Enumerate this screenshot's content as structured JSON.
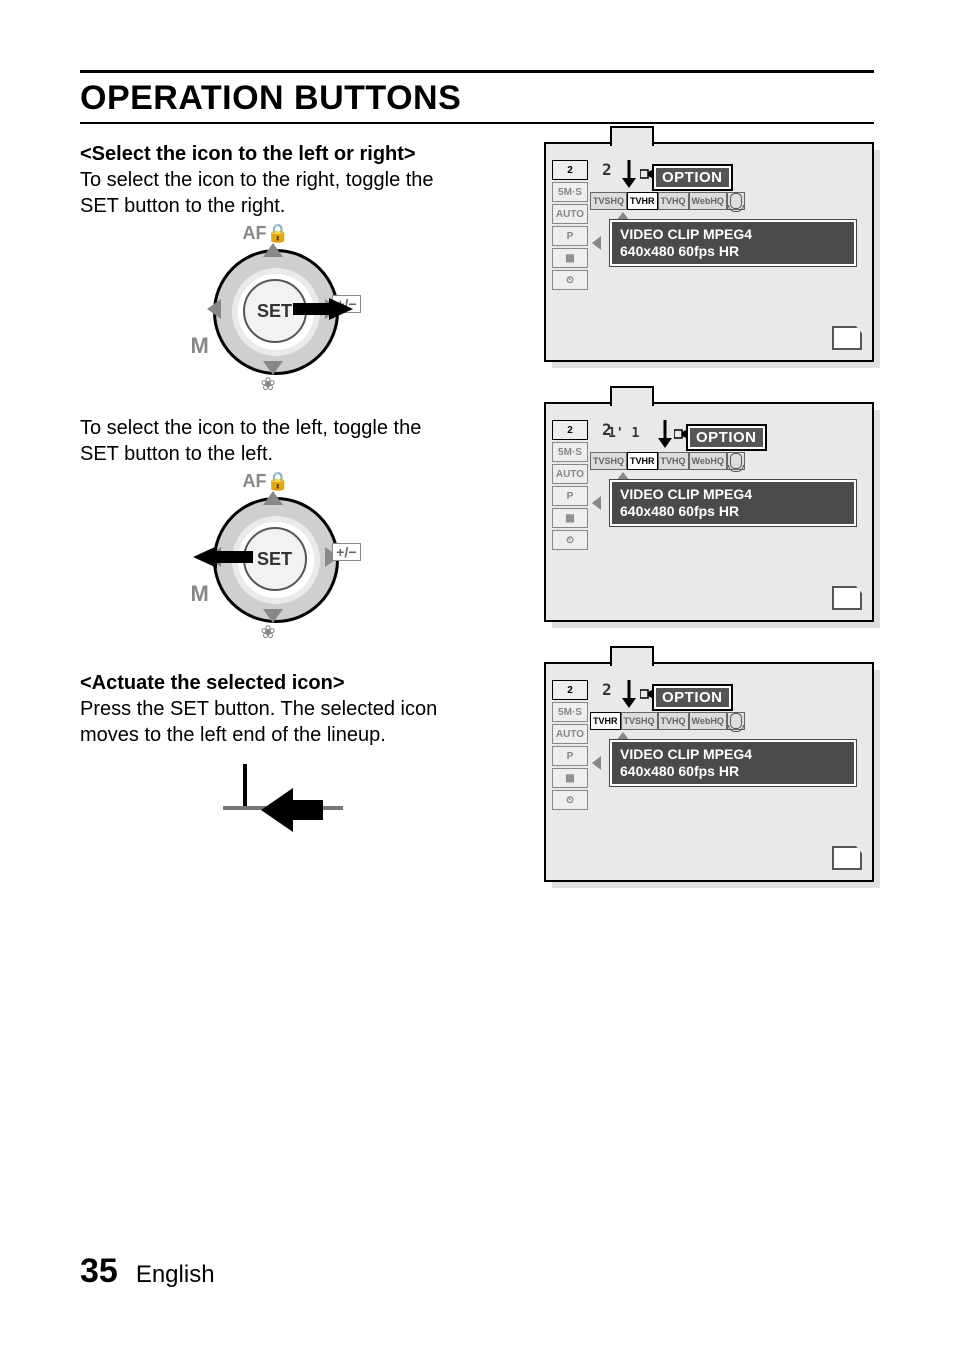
{
  "page": {
    "title": "OPERATION BUTTONS",
    "number": "35",
    "language": "English"
  },
  "section1": {
    "heading": "<Select the icon to the left or right>",
    "para1": "To select the icon to the right, toggle the SET button to the right.",
    "para2": "To select the icon to the left, toggle the SET button to the left."
  },
  "section2": {
    "heading": "<Actuate the selected icon>",
    "para": "Press the SET button. The selected icon moves to the left end of the lineup."
  },
  "dial": {
    "center": "SET",
    "labels": {
      "af": "AF",
      "m": "M",
      "ev": "+/−",
      "flower": "❀"
    }
  },
  "screen_common": {
    "option_label": "OPTION",
    "tooltip_line1": "VIDEO CLIP MPEG4",
    "tooltip_line2": "640x480 60fps HR",
    "tab_digit": "2",
    "left_items": [
      "2",
      "5M·S",
      "AUTO",
      "P",
      "▦",
      "⏲"
    ]
  },
  "screens": {
    "right_select": {
      "toprow": [
        "TVSHQ",
        "TVHR",
        "TVHQ",
        "WebHQ",
        "🎤"
      ],
      "selected_index": 1
    },
    "left_select": {
      "toprow": [
        "TVSHQ",
        "TVHR",
        "TVHQ",
        "WebHQ",
        "🎤"
      ],
      "selected_index": 1
    },
    "actuate": {
      "toprow": [
        "TVHR",
        "TVSHQ",
        "TVHQ",
        "WebHQ",
        "🎤"
      ],
      "selected_index": 0
    }
  }
}
